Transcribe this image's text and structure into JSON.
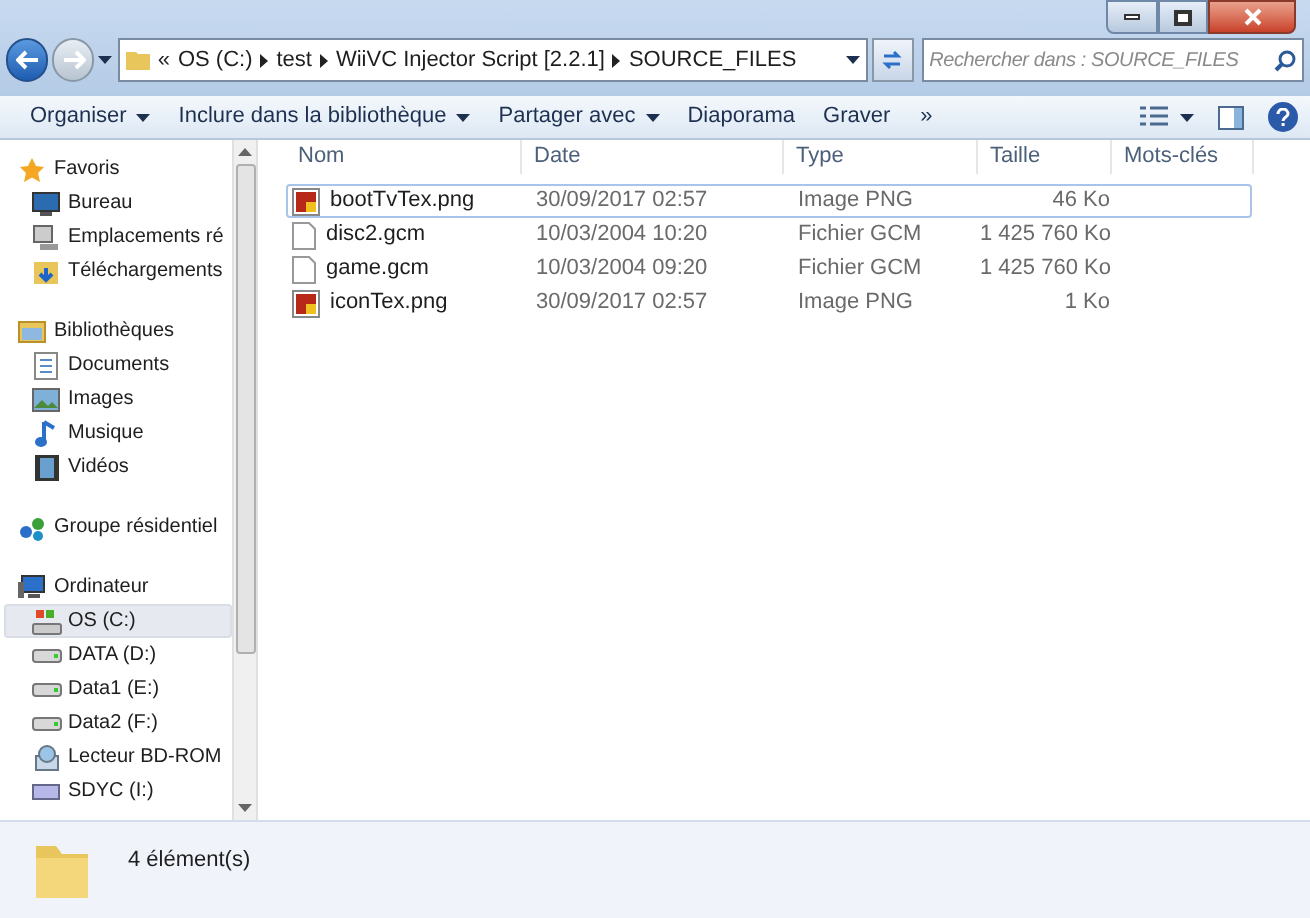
{
  "address": {
    "crumbs": [
      "«",
      "OS (C:)",
      "test",
      "WiiVC Injector Script [2.2.1]",
      "SOURCE_FILES"
    ]
  },
  "search": {
    "placeholder": "Rechercher dans : SOURCE_FILES"
  },
  "toolbar": {
    "buttons": [
      {
        "label": "Organiser",
        "dropdown": true
      },
      {
        "label": "Inclure dans la bibliothèque",
        "dropdown": true
      },
      {
        "label": "Partager avec",
        "dropdown": true
      },
      {
        "label": "Diaporama",
        "dropdown": false
      },
      {
        "label": "Graver",
        "dropdown": false
      }
    ],
    "more": "»"
  },
  "sidebar": {
    "groups": [
      {
        "label": "Favoris",
        "kind": "star",
        "children": [
          {
            "label": "Bureau",
            "kind": "desktop",
            "selected": false
          },
          {
            "label": "Emplacements ré",
            "kind": "network",
            "selected": false
          },
          {
            "label": "Téléchargements",
            "kind": "download",
            "selected": false
          }
        ]
      },
      {
        "label": "Bibliothèques",
        "kind": "library",
        "children": [
          {
            "label": "Documents",
            "kind": "doc",
            "selected": false
          },
          {
            "label": "Images",
            "kind": "image",
            "selected": false
          },
          {
            "label": "Musique",
            "kind": "music",
            "selected": false
          },
          {
            "label": "Vidéos",
            "kind": "video",
            "selected": false
          }
        ]
      },
      {
        "label": "Groupe résidentiel",
        "kind": "homegroup"
      },
      {
        "label": "Ordinateur",
        "kind": "computer",
        "children": [
          {
            "label": "OS (C:)",
            "kind": "drive-os",
            "selected": true
          },
          {
            "label": "DATA (D:)",
            "kind": "drive",
            "selected": false
          },
          {
            "label": "Data1 (E:)",
            "kind": "drive",
            "selected": false
          },
          {
            "label": "Data2 (F:)",
            "kind": "drive",
            "selected": false
          },
          {
            "label": "Lecteur BD-ROM",
            "kind": "disc",
            "selected": false
          },
          {
            "label": "SDYC (I:)",
            "kind": "card",
            "selected": false
          }
        ]
      }
    ]
  },
  "table": {
    "columns": [
      "Nom",
      "Date",
      "Type",
      "Taille",
      "Mots-clés"
    ],
    "rows": [
      {
        "name": "bootTvTex.png",
        "kind": "image",
        "date": "30/09/2017 02:57",
        "type": "Image PNG",
        "size": "46 Ko",
        "focused": true
      },
      {
        "name": "disc2.gcm",
        "kind": "file",
        "date": "10/03/2004 10:20",
        "type": "Fichier GCM",
        "size": "1 425 760 Ko",
        "focused": false
      },
      {
        "name": "game.gcm",
        "kind": "file",
        "date": "10/03/2004 09:20",
        "type": "Fichier GCM",
        "size": "1 425 760 Ko",
        "focused": false
      },
      {
        "name": "iconTex.png",
        "kind": "image",
        "date": "30/09/2017 02:57",
        "type": "Image PNG",
        "size": "1 Ko",
        "focused": false
      }
    ]
  },
  "status_bar": {
    "text": "4 élément(s)"
  }
}
